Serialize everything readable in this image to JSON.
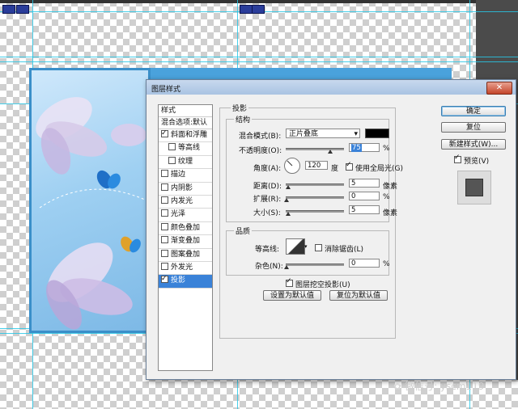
{
  "dialog": {
    "title": "图层样式",
    "close_glyph": "✕"
  },
  "left_panel": {
    "header": "样式",
    "blend_default": "混合选项:默认",
    "items": [
      {
        "label": "斜面和浮雕",
        "checked": true
      },
      {
        "label": "等高线",
        "checked": false
      },
      {
        "label": "纹理",
        "checked": false
      },
      {
        "label": "描边",
        "checked": false
      },
      {
        "label": "内阴影",
        "checked": false
      },
      {
        "label": "内发光",
        "checked": false
      },
      {
        "label": "光泽",
        "checked": false
      },
      {
        "label": "颜色叠加",
        "checked": false
      },
      {
        "label": "渐变叠加",
        "checked": false
      },
      {
        "label": "图案叠加",
        "checked": false
      },
      {
        "label": "外发光",
        "checked": false
      },
      {
        "label": "投影",
        "checked": true,
        "selected": true
      }
    ]
  },
  "shadow": {
    "section": "投影",
    "structure": "结构",
    "blend_mode_label": "混合模式(B):",
    "blend_mode_value": "正片叠底",
    "shadow_color": "#000000",
    "opacity_label": "不透明度(O):",
    "opacity_value": "75",
    "opacity_unit": "%",
    "angle_label": "角度(A):",
    "angle_value": "120",
    "angle_unit": "度",
    "global_light_label": "使用全局光(G)",
    "distance_label": "距离(D):",
    "distance_value": "5",
    "distance_unit": "像素",
    "spread_label": "扩展(R):",
    "spread_value": "0",
    "spread_unit": "%",
    "size_label": "大小(S):",
    "size_value": "5",
    "size_unit": "像素",
    "quality": "品质",
    "contour_label": "等高线:",
    "antialias_label": "消除锯齿(L)",
    "noise_label": "杂色(N):",
    "noise_value": "0",
    "noise_unit": "%",
    "knockout_label": "图层挖空投影(U)",
    "make_default": "设置为默认值",
    "reset_default": "复位为默认值"
  },
  "right_buttons": {
    "ok": "确定",
    "reset": "复位",
    "new_style": "新建样式(W)...",
    "preview_label": "预览(V)"
  },
  "watermark": "微信号: yscm119",
  "colors": {
    "selection": "#3a82d8",
    "guide": "#27c7e6",
    "frame": "#3a8fc9"
  }
}
